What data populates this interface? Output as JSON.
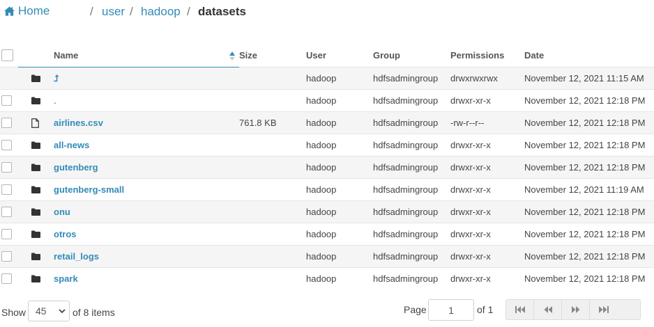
{
  "breadcrumb": {
    "home": "Home",
    "parts": [
      {
        "label": "user",
        "sep": "/"
      },
      {
        "label": "hadoop",
        "sep": "/"
      }
    ],
    "current": "datasets"
  },
  "table": {
    "columns": {
      "name": "Name",
      "size": "Size",
      "user": "User",
      "group": "Group",
      "permissions": "Permissions",
      "date": "Date"
    },
    "sort": {
      "column": "Name",
      "direction": "asc"
    },
    "rows": [
      {
        "icon": "folder-icon",
        "name": "⮥",
        "is_link": true,
        "size": "",
        "user": "hadoop",
        "group": "hdfsadmingroup",
        "permissions": "drwxrwxrwx",
        "date": "November 12, 2021 11:15 AM",
        "checkbox": false
      },
      {
        "icon": "folder-icon",
        "name": ".",
        "is_link": false,
        "size": "",
        "user": "hadoop",
        "group": "hdfsadmingroup",
        "permissions": "drwxr-xr-x",
        "date": "November 12, 2021 12:18 PM",
        "checkbox": true
      },
      {
        "icon": "file-icon",
        "name": "airlines.csv",
        "is_link": true,
        "size": "761.8 KB",
        "user": "hadoop",
        "group": "hdfsadmingroup",
        "permissions": "-rw-r--r--",
        "date": "November 12, 2021 12:18 PM",
        "checkbox": true
      },
      {
        "icon": "folder-icon",
        "name": "all-news",
        "is_link": true,
        "size": "",
        "user": "hadoop",
        "group": "hdfsadmingroup",
        "permissions": "drwxr-xr-x",
        "date": "November 12, 2021 12:18 PM",
        "checkbox": true
      },
      {
        "icon": "folder-icon",
        "name": "gutenberg",
        "is_link": true,
        "size": "",
        "user": "hadoop",
        "group": "hdfsadmingroup",
        "permissions": "drwxr-xr-x",
        "date": "November 12, 2021 12:18 PM",
        "checkbox": true
      },
      {
        "icon": "folder-icon",
        "name": "gutenberg-small",
        "is_link": true,
        "size": "",
        "user": "hadoop",
        "group": "hdfsadmingroup",
        "permissions": "drwxr-xr-x",
        "date": "November 12, 2021 11:19 AM",
        "checkbox": true
      },
      {
        "icon": "folder-icon",
        "name": "onu",
        "is_link": true,
        "size": "",
        "user": "hadoop",
        "group": "hdfsadmingroup",
        "permissions": "drwxr-xr-x",
        "date": "November 12, 2021 12:18 PM",
        "checkbox": true
      },
      {
        "icon": "folder-icon",
        "name": "otros",
        "is_link": true,
        "size": "",
        "user": "hadoop",
        "group": "hdfsadmingroup",
        "permissions": "drwxr-xr-x",
        "date": "November 12, 2021 12:18 PM",
        "checkbox": true
      },
      {
        "icon": "folder-icon",
        "name": "retail_logs",
        "is_link": true,
        "size": "",
        "user": "hadoop",
        "group": "hdfsadmingroup",
        "permissions": "drwxr-xr-x",
        "date": "November 12, 2021 12:18 PM",
        "checkbox": true
      },
      {
        "icon": "folder-icon",
        "name": "spark",
        "is_link": true,
        "size": "",
        "user": "hadoop",
        "group": "hdfsadmingroup",
        "permissions": "drwxr-xr-x",
        "date": "November 12, 2021 12:18 PM",
        "checkbox": true
      }
    ]
  },
  "footer": {
    "show_label": "Show",
    "page_size": "45",
    "items_text": "of 8 items",
    "page_label": "Page",
    "page_value": "1",
    "pages_text": "of 1",
    "pager_buttons": [
      "first-page-icon",
      "previous-page-icon",
      "next-page-icon",
      "last-page-icon"
    ]
  },
  "colors": {
    "link": "#338bb8",
    "text": "#444444",
    "stripe": "#f5f5f5",
    "border": "#e5e5e5"
  }
}
